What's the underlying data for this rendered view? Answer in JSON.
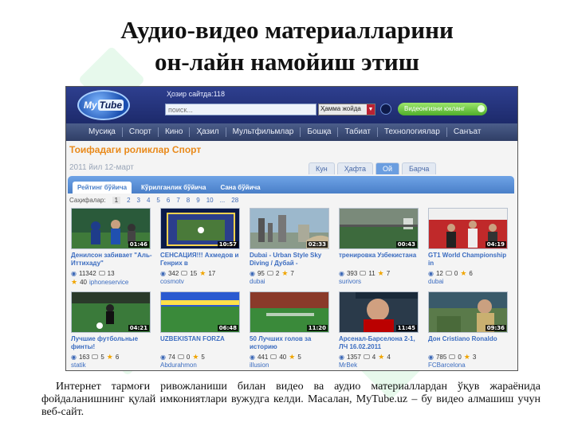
{
  "slide": {
    "title_line1": "Аудио-видео материалларини",
    "title_line2": "он-лайн намойиш этиш",
    "caption": "Интернет тармоғи ривожланиши билан видео ва аудио материаллардан ўқув жараёнида фойдаланишнинг қулай имкониятлари вужудга келди. Масалан, MyTube.uz – бу видео алмашиш учун веб-сайт."
  },
  "site": {
    "logo_my": "My",
    "logo_tube": "Tube",
    "online": "Ҳозир сайтда:118",
    "search_placeholder": "поиск...",
    "search_scope": "Ҳамма жойда",
    "upload_label": "Видеонгизни юкланг"
  },
  "nav": [
    "Мусиқа",
    "Спорт",
    "Кино",
    "Ҳазил",
    "Мультфильмлар",
    "Бошқа",
    "Табиат",
    "Технологиялар",
    "Санъат"
  ],
  "section": {
    "title": "Тоифадаги роликлар Спорт",
    "date": "2011 йил 12-март",
    "period_tabs": [
      "Кун",
      "Ҳафта",
      "Ой",
      "Барча"
    ],
    "active_period": "Ой",
    "sort_tabs": [
      "Рейтинг бўйича",
      "Кўрилганлик бўйича",
      "Сана бўйича"
    ],
    "active_sort": "Рейтинг бўйича",
    "pages_label": "Саҳифалар:",
    "pages": [
      "1",
      "2",
      "3",
      "4",
      "5",
      "6",
      "7",
      "8",
      "9",
      "10",
      "...",
      "28"
    ]
  },
  "videos": [
    {
      "title": "Денилсон забивает \"Аль-Иттихаду\"",
      "duration": "01:46",
      "views": "11342",
      "comments": "13",
      "rating_count": "40",
      "author": "iphoneservice",
      "thumb": "players"
    },
    {
      "title": "СЕНСАЦИЯ!!! Ахмедов и Генрих в",
      "duration": "10:57",
      "views": "342",
      "comments": "15",
      "rating": "17",
      "author": "cosmotv",
      "thumb": "tvstudio"
    },
    {
      "title": "Dubai - Urban Style Sky Diving / Дубай -",
      "duration": "02:33",
      "views": "95",
      "comments": "2",
      "rating": "7",
      "author": "dubai",
      "thumb": "city"
    },
    {
      "title": "тренировка Узбекистана",
      "duration": "00:43",
      "views": "393",
      "comments": "11",
      "rating": "7",
      "author": "surivors",
      "thumb": "field"
    },
    {
      "title": "GT1 World Championship in",
      "duration": "04:19",
      "views": "12",
      "comments": "0",
      "rating": "6",
      "author": "dubai",
      "thumb": "podium"
    },
    {
      "title": "Лучшие футбольные финты!",
      "duration": "04:21",
      "views": "163",
      "comments": "5",
      "rating": "6",
      "author": "statik",
      "thumb": "action"
    },
    {
      "title": "UZBEKISTAN FORZA",
      "duration": "06:48",
      "views": "74",
      "comments": "0",
      "rating": "5",
      "author": "Abdurahmon",
      "thumb": "stadium"
    },
    {
      "title": "50 Лучших голов за историю",
      "duration": "11:20",
      "views": "441",
      "comments": "40",
      "rating": "5",
      "author": "illusion",
      "thumb": "crowd"
    },
    {
      "title": "Арсенал-Барселона 2-1, ЛЧ 16.02.2011",
      "duration": "11:45",
      "views": "1357",
      "comments": "4",
      "rating": "4",
      "author": "MrBek",
      "thumb": "closeup"
    },
    {
      "title": "Дон Cristiano Ronaldo",
      "duration": "09:36",
      "views": "785",
      "comments": "0",
      "rating": "3",
      "author": "FCBarcelona",
      "thumb": "portrait"
    }
  ],
  "colors": {
    "section_title": "#e98a1b",
    "link": "#3b6cc0",
    "header_bg": "#2e3f8f",
    "sort_bar": "#6ea3e6",
    "upload_btn": "#5fbf35"
  }
}
